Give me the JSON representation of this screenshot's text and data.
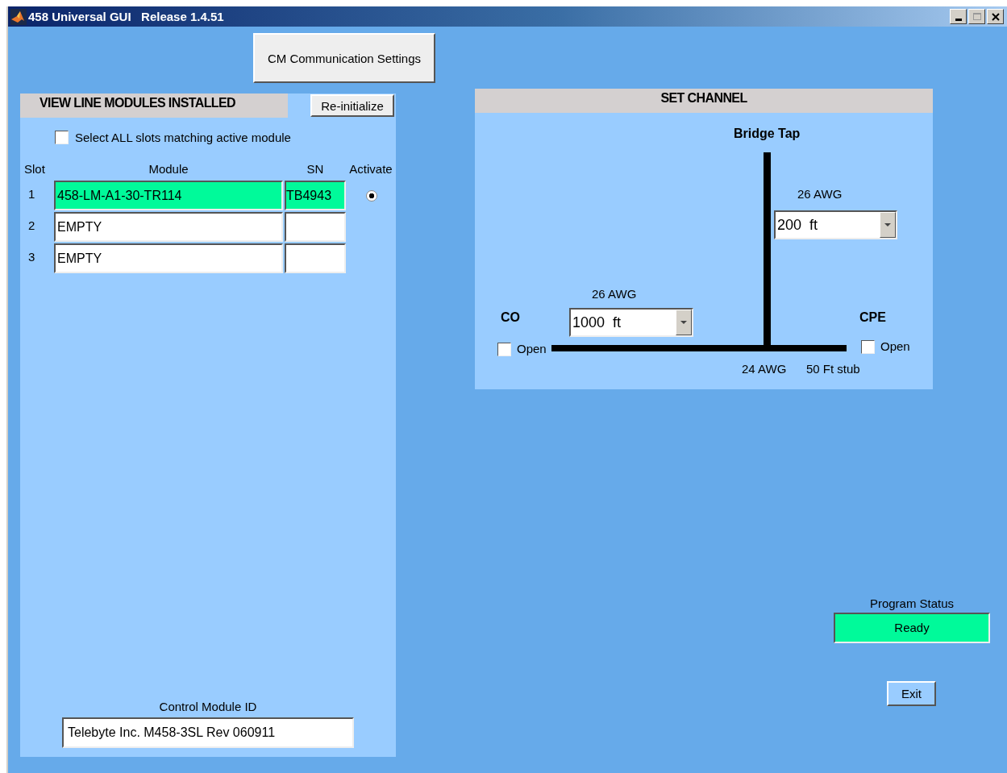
{
  "window": {
    "title": "458 Universal GUI   Release 1.4.51"
  },
  "cm_settings_button": "CM Communication Settings",
  "line_modules": {
    "title": "VIEW LINE MODULES INSTALLED",
    "reinit_button": "Re-initialize",
    "select_all": {
      "label": "Select ALL slots matching active module",
      "checked": false
    },
    "columns": [
      "Slot",
      "Module",
      "SN",
      "Activate"
    ],
    "rows": [
      {
        "slot": "1",
        "module": "458-LM-A1-30-TR114",
        "sn": "TB4943",
        "color": "#00fa9a",
        "radio": {
          "selected": true
        }
      },
      {
        "slot": "2",
        "module": "EMPTY",
        "color": "#ffffff"
      },
      {
        "slot": "3",
        "module": "EMPTY",
        "color": "#ffffff"
      }
    ],
    "control_module": {
      "label": "Control Module ID",
      "value": "Telebyte Inc. M458-3SL Rev 060911"
    }
  },
  "set_channel": {
    "title": "SET CHANNEL",
    "bridge_tap_label": "Bridge Tap",
    "bridge_gauge": "26 AWG",
    "bridge_length": "200  ft",
    "loop_gauge": "26 AWG",
    "loop_length": "1000  ft",
    "co": {
      "label": "CO",
      "open_label": "Open",
      "checked": false
    },
    "cpe": {
      "label": "CPE",
      "open_label": "Open",
      "checked": false
    },
    "stub_gauge": "24 AWG",
    "stub_length": "50 Ft stub"
  },
  "program_status": {
    "label": "Program Status",
    "value": "Ready"
  },
  "exit_button": "Exit"
}
